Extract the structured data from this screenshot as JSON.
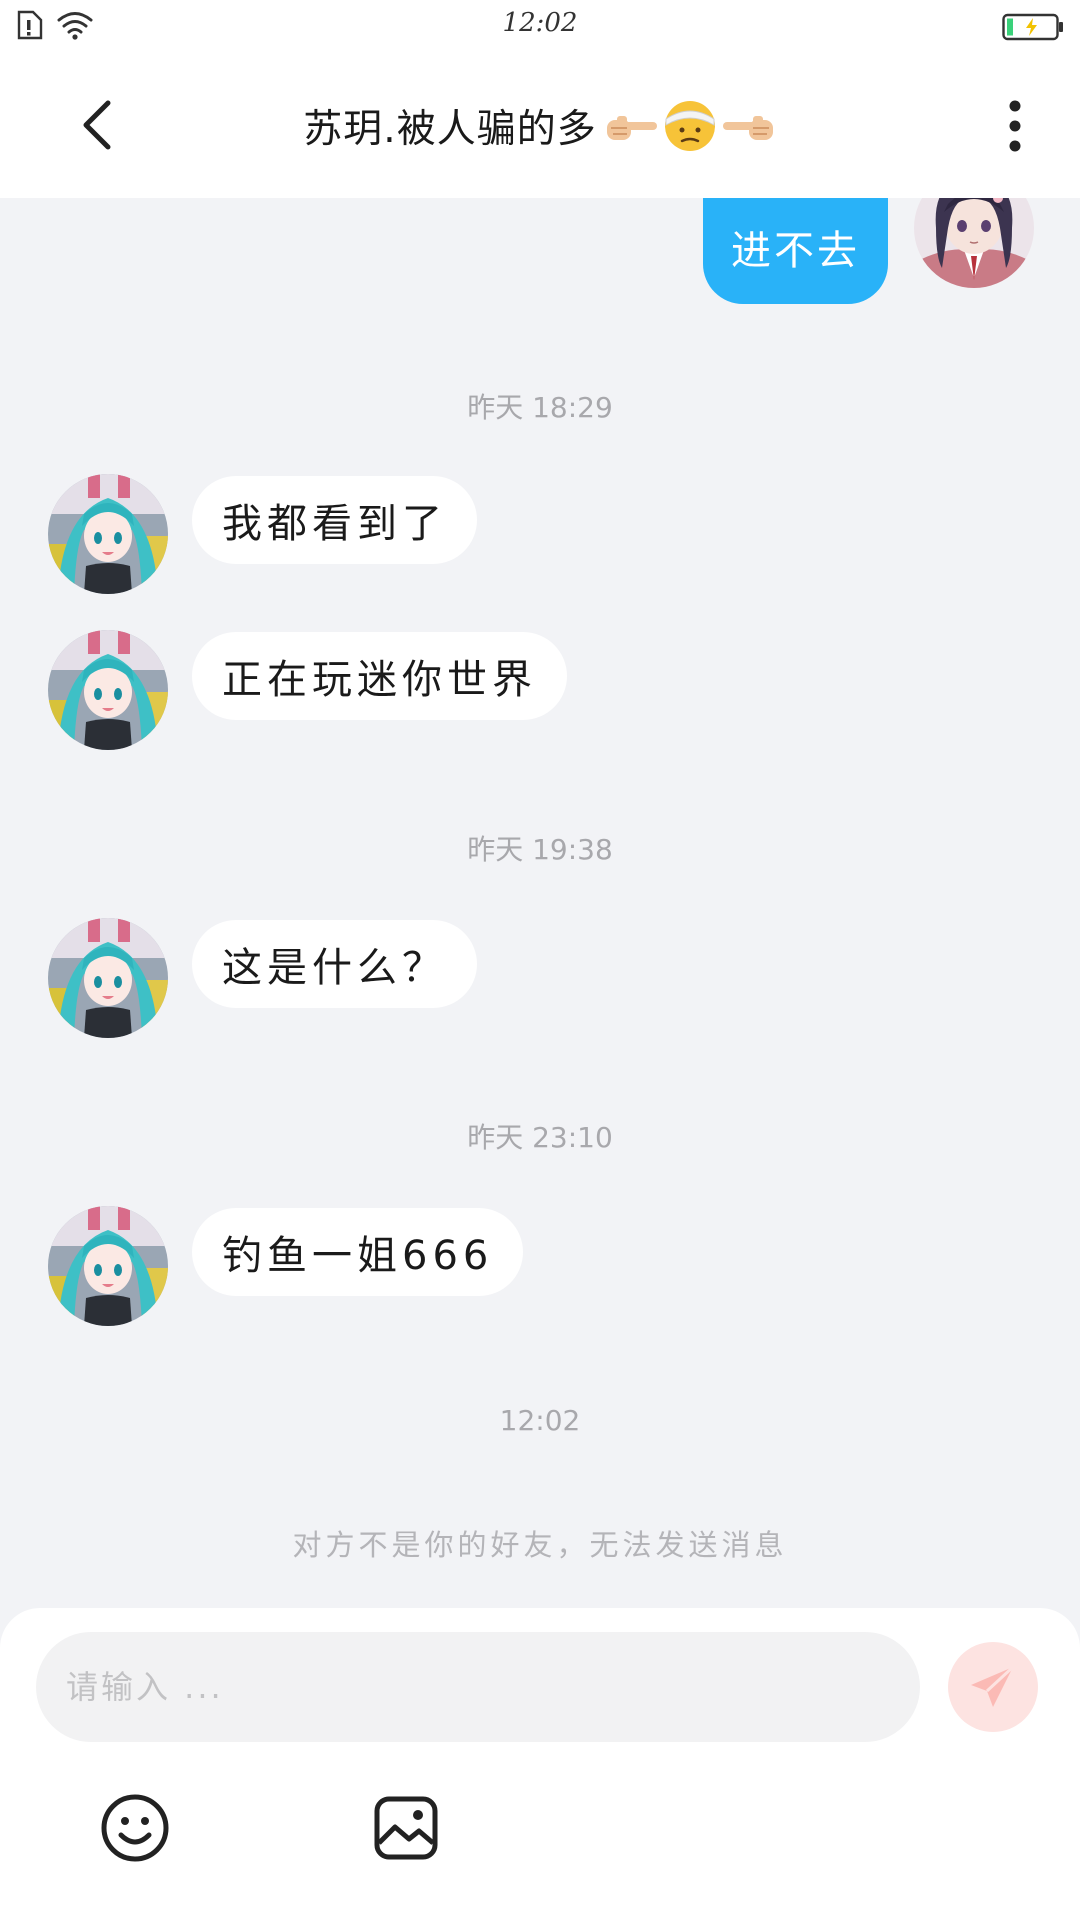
{
  "status_bar": {
    "time": "12:02"
  },
  "header": {
    "title": "苏玥.被人骗的多"
  },
  "messages": {
    "outgoing_0": "进不去",
    "ts_1": "昨天 18:29",
    "in_1": "我都看到了",
    "in_2": "正在玩迷你世界",
    "ts_2": "昨天 19:38",
    "in_3": "这是什么？",
    "ts_3": "昨天 23:10",
    "in_4": "钓鱼一姐666",
    "ts_4": "12:02",
    "notice": "对方不是你的好友，无法发送消息"
  },
  "composer": {
    "placeholder": "请输入 ..."
  },
  "colors": {
    "accent_blue": "#29b2f8",
    "send_disabled": "#fde3e1",
    "background": "#f2f3f6"
  },
  "icons": [
    "back-chevron-icon",
    "more-vertical-icon",
    "send-icon",
    "emoji-icon",
    "image-icon",
    "wifi-icon",
    "sim-alert-icon",
    "battery-charging-icon"
  ]
}
